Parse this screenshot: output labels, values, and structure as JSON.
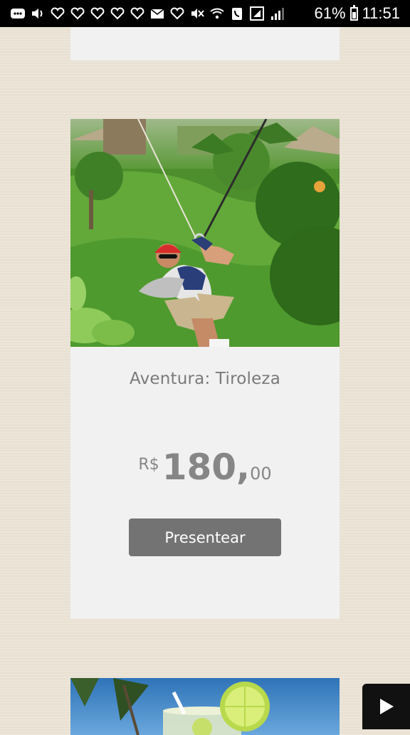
{
  "status_bar": {
    "battery_percent": "61%",
    "battery_level": 0.61,
    "time": "11:51",
    "icons": [
      "message-icon",
      "volume-icon",
      "heart-icon",
      "heart-icon",
      "heart-icon",
      "heart-icon",
      "heart-icon",
      "mail-icon",
      "heart-icon",
      "mute-icon",
      "wifi-call-icon",
      "phone-icon",
      "signal-box-icon",
      "cell-signal-icon",
      "battery-icon"
    ]
  },
  "product": {
    "title": "Aventura: Tiroleza",
    "price_currency": "R$",
    "price_integer": "180,",
    "price_cents": "00",
    "button_label": "Presentear",
    "image_subject": "zipline-photo"
  },
  "next_product": {
    "image_subject": "cocktail-beach-photo"
  },
  "colors": {
    "background": "#ebe4d6",
    "card": "#f1f1f1",
    "button": "#737373",
    "text_gray": "#7a7a7a"
  }
}
